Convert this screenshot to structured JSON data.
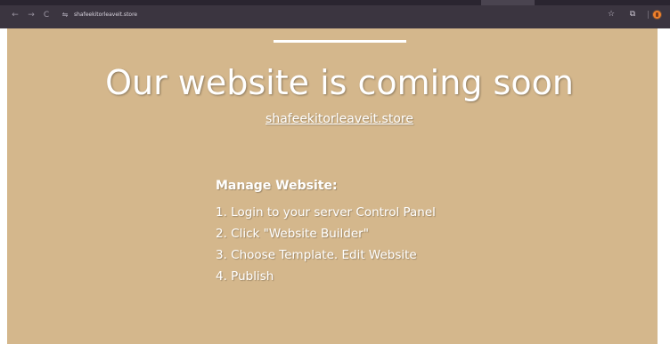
{
  "browser": {
    "back_glyph": "←",
    "forward_glyph": "→",
    "reload_glyph": "C",
    "site_info_glyph": "⇋",
    "address": "shafeekitorleaveit.store",
    "star_glyph": "☆",
    "extensions_glyph": "⧉",
    "icons": [
      "back-arrow-icon",
      "forward-arrow-icon",
      "reload-icon",
      "site-info-icon",
      "bookmark-star-icon",
      "extensions-icon",
      "profile-avatar-icon"
    ]
  },
  "page": {
    "headline": "Our website is coming soon",
    "domain": "shafeekitorleaveit.store",
    "manage_heading": "Manage Website:",
    "steps": [
      "1. Login to your server Control Panel",
      "2. Click \"Website Builder\"",
      "3. Choose Template. Edit Website",
      "4. Publish"
    ]
  },
  "colors": {
    "toolbar": "#3b3540",
    "page_background": "#d4b78c",
    "text": "#ffffff",
    "profile_accent": "#f0812a"
  }
}
